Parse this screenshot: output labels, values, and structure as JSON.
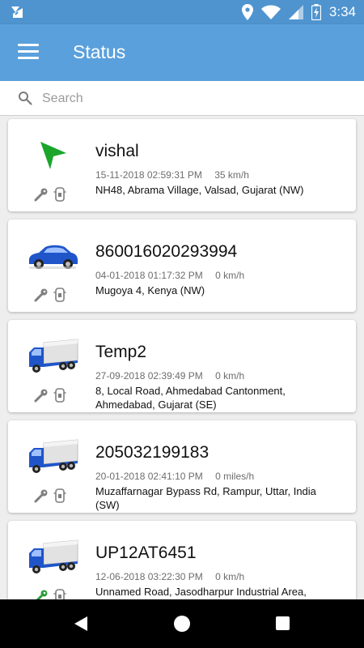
{
  "status_bar": {
    "time": "3:34",
    "icons": [
      "app-notification-icon",
      "location-icon",
      "wifi-icon",
      "signal-icon",
      "battery-charging-icon"
    ]
  },
  "app_bar": {
    "title": "Status",
    "menu_icon": "hamburger-menu-icon"
  },
  "search": {
    "placeholder": "Search",
    "value": ""
  },
  "vehicles": [
    {
      "name": "vishal",
      "datetime": "15-11-2018 02:59:31 PM",
      "speed": "35 km/h",
      "address": "NH48, Abrama Village, Valsad, Gujarat (NW)",
      "icon": "green-navigation-arrow-icon",
      "key_color": "#7f7f7f"
    },
    {
      "name": "860016020293994",
      "datetime": "04-01-2018 01:17:32 PM",
      "speed": "0 km/h",
      "address": "Mugoya 4, Kenya (NW)",
      "icon": "blue-car-icon",
      "key_color": "#7f7f7f"
    },
    {
      "name": "Temp2",
      "datetime": "27-09-2018 02:39:49 PM",
      "speed": "0 km/h",
      "address": "8, Local Road, Ahmedabad Cantonment, Ahmedabad, Gujarat (SE)",
      "icon": "blue-truck-icon",
      "key_color": "#7f7f7f"
    },
    {
      "name": "205032199183",
      "datetime": "20-01-2018 02:41:10 PM",
      "speed": "0 miles/h",
      "address": "Muzaffarnagar Bypass Rd, Rampur, Uttar, India (SW)",
      "icon": "blue-truck-icon",
      "key_color": "#7f7f7f"
    },
    {
      "name": "UP12AT6451",
      "datetime": "12-06-2018 03:22:30 PM",
      "speed": "0 km/h",
      "address": "Unnamed Road, Jasodharpur Industrial Area, Trilokpur, Uttarakhand, India (SW)",
      "icon": "blue-truck-icon",
      "key_color": "#2e9d3c"
    }
  ],
  "colors": {
    "status_bar": "#4f94cf",
    "app_bar": "#5aa0dc",
    "background": "#eeeeee",
    "arrow_green": "#1aa52b",
    "vehicle_blue": "#1f55c9"
  },
  "nav_bar": {
    "icons": [
      "back-icon",
      "home-icon",
      "recents-icon"
    ]
  }
}
